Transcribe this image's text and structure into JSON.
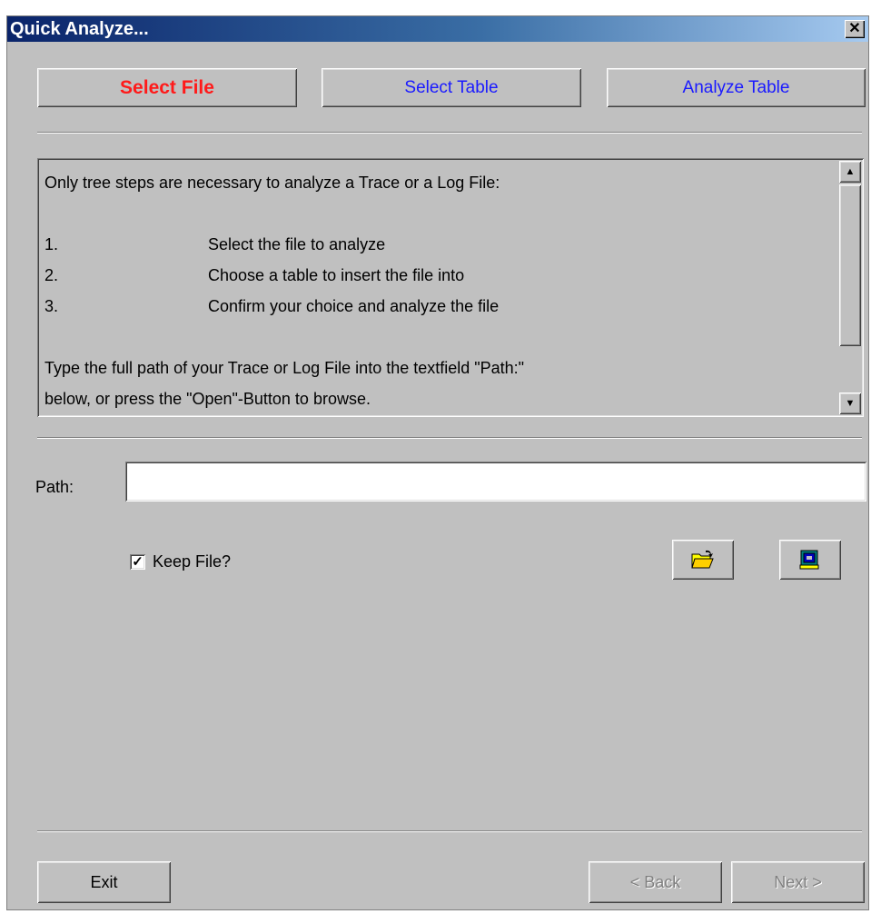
{
  "window": {
    "title": "Quick Analyze...",
    "close_glyph": "✕"
  },
  "steps": [
    {
      "label": "Select File",
      "active": true,
      "color": "#ff1a1a"
    },
    {
      "label": "Select Table",
      "active": false,
      "color": "#1a1aff"
    },
    {
      "label": "Analyze Table",
      "active": false,
      "color": "#1a1aff"
    }
  ],
  "info": {
    "intro": "Only tree steps are necessary to analyze a Trace or a Log File:",
    "steps": [
      {
        "num": "1.",
        "text": "Select the file to analyze"
      },
      {
        "num": "2.",
        "text": "Choose a table to insert the file into"
      },
      {
        "num": "3.",
        "text": "Confirm your choice and analyze the file"
      }
    ],
    "line1": "Type the full path of your Trace or Log File into the textfield \"Path:\"",
    "line2": "below, or press the \"Open\"-Button to browse."
  },
  "path": {
    "label": "Path:",
    "value": ""
  },
  "keep_file": {
    "label": "Keep File?",
    "checked": true
  },
  "icons": {
    "open": "open-folder-icon",
    "other": "window-icon"
  },
  "buttons": {
    "exit": "Exit",
    "back": "< Back",
    "next": "Next >"
  }
}
